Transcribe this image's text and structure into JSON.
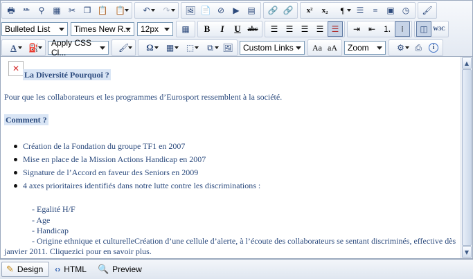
{
  "toolbar": {
    "block_format": "Bulleted List",
    "font_name": "Times New R...",
    "font_size": "12px",
    "css_class": "Apply CSS Cl...",
    "links": "Custom Links",
    "zoom": "Zoom",
    "bold": "B",
    "italic": "I",
    "underline": "U",
    "strike": "abc",
    "sup": "x²",
    "sub": "x₂",
    "symbol": "Ω"
  },
  "document": {
    "heading1": "La Diversité Pourquoi ?",
    "paragraph1": "Pour que les collaborateurs et les programmes d’Eurosport ressemblent à la société.",
    "heading2": "Comment ?",
    "bullets": [
      "Création de la Fondation du groupe TF1 en 2007",
      "Mise en place de la Mission Actions Handicap en 2007",
      "Signature de l’Accord en faveur des Seniors en 2009",
      "4 axes prioritaires identifiés dans notre lutte contre les discriminations :"
    ],
    "axes": [
      "- Egalité H/F",
      "- Age",
      "- Handicap",
      "- Origine ethnique et culturelleCréation d’une cellule d’alerte, à l’écoute des collaborateurs se sentant discriminés, effective dès"
    ],
    "axes_wrap": "janvier 2011. Cliquezici pour en savoir plus."
  },
  "modes": {
    "design": "Design",
    "html": "HTML",
    "preview": "Preview"
  },
  "colors": {
    "text": "#2b4a7d",
    "highlight": "#d9e5f5",
    "toolbar_bg": "#e3e9f2"
  }
}
